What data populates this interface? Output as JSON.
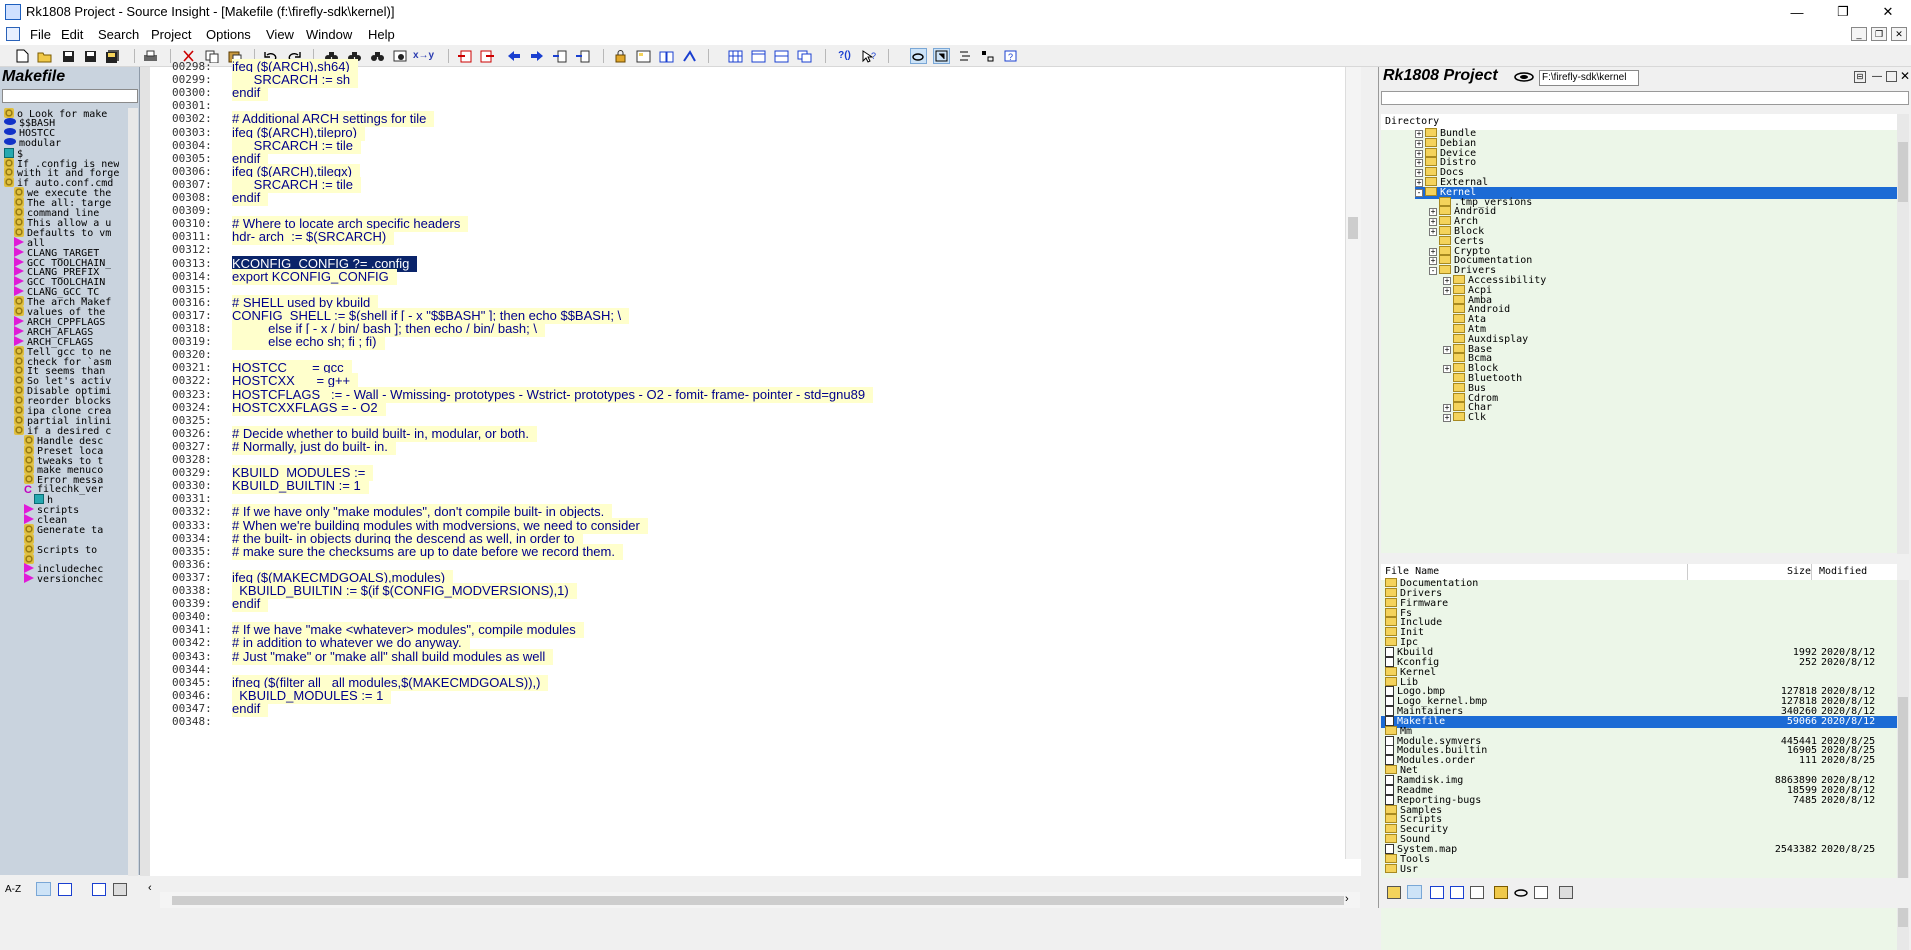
{
  "window": {
    "title": "Rk1808 Project - Source Insight - [Makefile (f:\\firefly-sdk\\kernel)]",
    "minimize": "—",
    "maximize": "❐",
    "close": "✕"
  },
  "menu": {
    "items": [
      "File",
      "Edit",
      "Search",
      "Project",
      "Options",
      "View",
      "Window",
      "Help"
    ],
    "mdi_buttons": [
      "_",
      "❐",
      "✕"
    ]
  },
  "symbol_panel": {
    "title": "Makefile",
    "items": [
      {
        "icon": "gear-icon",
        "text": "o Look for make",
        "indent": 0
      },
      {
        "icon": "variable-icon",
        "text": "$$BASH",
        "indent": 0
      },
      {
        "icon": "variable-icon",
        "text": "HOSTCC",
        "indent": 0
      },
      {
        "icon": "variable-icon",
        "text": "modular",
        "indent": 0
      },
      {
        "icon": "file-icon",
        "text": "$",
        "indent": 0
      },
      {
        "icon": "gear-icon",
        "text": "If .config is new",
        "indent": 0
      },
      {
        "icon": "gear-icon",
        "text": "with it and forge",
        "indent": 0
      },
      {
        "icon": "gear-icon",
        "text": "if auto.conf.cmd",
        "indent": 0
      },
      {
        "icon": "gear-icon",
        "text": "we execute the",
        "indent": 1
      },
      {
        "icon": "gear-icon",
        "text": "The all: targe",
        "indent": 1
      },
      {
        "icon": "gear-icon",
        "text": "command line",
        "indent": 1
      },
      {
        "icon": "gear-icon",
        "text": "This allow a u",
        "indent": 1
      },
      {
        "icon": "gear-icon",
        "text": "Defaults to vm",
        "indent": 1
      },
      {
        "icon": "target-icon",
        "text": "all",
        "indent": 1
      },
      {
        "icon": "target-icon",
        "text": "CLANG_TARGET",
        "indent": 1
      },
      {
        "icon": "target-icon",
        "text": "GCC_TOOLCHAIN_",
        "indent": 1
      },
      {
        "icon": "target-icon",
        "text": "CLANG_PREFIX",
        "indent": 1
      },
      {
        "icon": "target-icon",
        "text": "GCC_TOOLCHAIN",
        "indent": 1
      },
      {
        "icon": "target-icon",
        "text": "CLANG_GCC_TC",
        "indent": 1
      },
      {
        "icon": "gear-icon",
        "text": "The arch Makef",
        "indent": 1
      },
      {
        "icon": "gear-icon",
        "text": "values of the",
        "indent": 1
      },
      {
        "icon": "target-icon",
        "text": "ARCH_CPPFLAGS",
        "indent": 1
      },
      {
        "icon": "target-icon",
        "text": "ARCH_AFLAGS",
        "indent": 1
      },
      {
        "icon": "target-icon",
        "text": "ARCH_CFLAGS",
        "indent": 1
      },
      {
        "icon": "gear-icon",
        "text": "Tell gcc to ne",
        "indent": 1
      },
      {
        "icon": "gear-icon",
        "text": "check for `asm",
        "indent": 1
      },
      {
        "icon": "gear-icon",
        "text": "It seems than",
        "indent": 1
      },
      {
        "icon": "gear-icon",
        "text": "So let's activ",
        "indent": 1
      },
      {
        "icon": "gear-icon",
        "text": "Disable optimi",
        "indent": 1
      },
      {
        "icon": "gear-icon",
        "text": "reorder blocks",
        "indent": 1
      },
      {
        "icon": "gear-icon",
        "text": "ipa clone crea",
        "indent": 1
      },
      {
        "icon": "gear-icon",
        "text": "partial inlini",
        "indent": 1
      },
      {
        "icon": "gear-icon",
        "text": "if a desired c",
        "indent": 1
      },
      {
        "icon": "gear-icon",
        "text": "Handle desc",
        "indent": 2
      },
      {
        "icon": "gear-icon",
        "text": "Preset loca",
        "indent": 2
      },
      {
        "icon": "gear-icon",
        "text": "tweaks to t",
        "indent": 2
      },
      {
        "icon": "gear-icon",
        "text": "make menuco",
        "indent": 2
      },
      {
        "icon": "gear-icon",
        "text": "Error messa",
        "indent": 2
      },
      {
        "icon": "c-icon",
        "text": "filechk_ver",
        "indent": 2
      },
      {
        "icon": "file-icon",
        "text": "h",
        "indent": 3
      },
      {
        "icon": "target-icon",
        "text": "scripts",
        "indent": 2
      },
      {
        "icon": "target-icon",
        "text": "clean",
        "indent": 2
      },
      {
        "icon": "gear-icon",
        "text": "Generate ta",
        "indent": 2
      },
      {
        "icon": "gear-icon",
        "text": "",
        "indent": 2
      },
      {
        "icon": "gear-icon",
        "text": "Scripts to",
        "indent": 2
      },
      {
        "icon": "gear-icon",
        "text": "",
        "indent": 2
      },
      {
        "icon": "target-icon",
        "text": "includechec",
        "indent": 2
      },
      {
        "icon": "target-icon",
        "text": "versionchec",
        "indent": 2
      }
    ]
  },
  "editor": {
    "lines": [
      {
        "num": "00298:",
        "text": "ifeq ($(ARCH),sh64)"
      },
      {
        "num": "00299:",
        "text": "      SRCARCH := sh"
      },
      {
        "num": "00300:",
        "text": "endif"
      },
      {
        "num": "00301:",
        "text": ""
      },
      {
        "num": "00302:",
        "text": "# Additional ARCH settings for tile"
      },
      {
        "num": "00303:",
        "text": "ifeq ($(ARCH),tilepro)"
      },
      {
        "num": "00304:",
        "text": "      SRCARCH := tile"
      },
      {
        "num": "00305:",
        "text": "endif"
      },
      {
        "num": "00306:",
        "text": "ifeq ($(ARCH),tilegx)"
      },
      {
        "num": "00307:",
        "text": "      SRCARCH := tile"
      },
      {
        "num": "00308:",
        "text": "endif"
      },
      {
        "num": "00309:",
        "text": ""
      },
      {
        "num": "00310:",
        "text": "# Where to locate arch specific headers"
      },
      {
        "num": "00311:",
        "text": "hdr- arch  := $(SRCARCH)"
      },
      {
        "num": "00312:",
        "text": ""
      },
      {
        "num": "00313:",
        "text": "KCONFIG_CONFIG ?= .config",
        "selected": true
      },
      {
        "num": "00314:",
        "text": "export KCONFIG_CONFIG"
      },
      {
        "num": "00315:",
        "text": ""
      },
      {
        "num": "00316:",
        "text": "# SHELL used by kbuild"
      },
      {
        "num": "00317:",
        "text": "CONFIG_SHELL := $(shell if [ - x \"$$BASH\" ]; then echo $$BASH; \\"
      },
      {
        "num": "00318:",
        "text": "          else if [ - x / bin/ bash ]; then echo / bin/ bash; \\"
      },
      {
        "num": "00319:",
        "text": "          else echo sh; fi ; fi)"
      },
      {
        "num": "00320:",
        "text": ""
      },
      {
        "num": "00321:",
        "text": "HOSTCC       = gcc"
      },
      {
        "num": "00322:",
        "text": "HOSTCXX      = g++"
      },
      {
        "num": "00323:",
        "text": "HOSTCFLAGS   := - Wall - Wmissing- prototypes - Wstrict- prototypes - O2 - fomit- frame- pointer - std=gnu89"
      },
      {
        "num": "00324:",
        "text": "HOSTCXXFLAGS = - O2"
      },
      {
        "num": "00325:",
        "text": ""
      },
      {
        "num": "00326:",
        "text": "# Decide whether to build built- in, modular, or both."
      },
      {
        "num": "00327:",
        "text": "# Normally, just do built- in."
      },
      {
        "num": "00328:",
        "text": ""
      },
      {
        "num": "00329:",
        "text": "KBUILD_MODULES :="
      },
      {
        "num": "00330:",
        "text": "KBUILD_BUILTIN := 1"
      },
      {
        "num": "00331:",
        "text": ""
      },
      {
        "num": "00332:",
        "text": "# If we have only \"make modules\", don't compile built- in objects."
      },
      {
        "num": "00333:",
        "text": "# When we're building modules with modversions, we need to consider"
      },
      {
        "num": "00334:",
        "text": "# the built- in objects during the descend as well, in order to"
      },
      {
        "num": "00335:",
        "text": "# make sure the checksums are up to date before we record them."
      },
      {
        "num": "00336:",
        "text": ""
      },
      {
        "num": "00337:",
        "text": "ifeq ($(MAKECMDGOALS),modules)"
      },
      {
        "num": "00338:",
        "text": "  KBUILD_BUILTIN := $(if $(CONFIG_MODVERSIONS),1)"
      },
      {
        "num": "00339:",
        "text": "endif"
      },
      {
        "num": "00340:",
        "text": ""
      },
      {
        "num": "00341:",
        "text": "# If we have \"make <whatever> modules\", compile modules"
      },
      {
        "num": "00342:",
        "text": "# in addition to whatever we do anyway."
      },
      {
        "num": "00343:",
        "text": "# Just \"make\" or \"make all\" shall build modules as well"
      },
      {
        "num": "00344:",
        "text": ""
      },
      {
        "num": "00345:",
        "text": "ifneq ($(filter all _all modules,$(MAKECMDGOALS)),)"
      },
      {
        "num": "00346:",
        "text": "  KBUILD_MODULES := 1"
      },
      {
        "num": "00347:",
        "text": "endif"
      },
      {
        "num": "00348:",
        "text": ""
      }
    ]
  },
  "project_panel": {
    "title": "Rk1808 Project",
    "path": "F:\\firefly-sdk\\kernel",
    "directory_header": "Directory",
    "tree": [
      {
        "label": "Bundle",
        "level": 0,
        "expander": "+"
      },
      {
        "label": "Debian",
        "level": 0,
        "expander": "+"
      },
      {
        "label": "Device",
        "level": 0,
        "expander": "+"
      },
      {
        "label": "Distro",
        "level": 0,
        "expander": "+"
      },
      {
        "label": "Docs",
        "level": 0,
        "expander": "+"
      },
      {
        "label": "External",
        "level": 0,
        "expander": "+"
      },
      {
        "label": "Kernel",
        "level": 0,
        "expander": "-",
        "selected": true
      },
      {
        "label": ".tmp_versions",
        "level": 1,
        "expander": ""
      },
      {
        "label": "Android",
        "level": 1,
        "expander": "+"
      },
      {
        "label": "Arch",
        "level": 1,
        "expander": "+"
      },
      {
        "label": "Block",
        "level": 1,
        "expander": "+"
      },
      {
        "label": "Certs",
        "level": 1,
        "expander": ""
      },
      {
        "label": "Crypto",
        "level": 1,
        "expander": "+"
      },
      {
        "label": "Documentation",
        "level": 1,
        "expander": "+"
      },
      {
        "label": "Drivers",
        "level": 1,
        "expander": "-"
      },
      {
        "label": "Accessibility",
        "level": 2,
        "expander": "+"
      },
      {
        "label": "Acpi",
        "level": 2,
        "expander": "+"
      },
      {
        "label": "Amba",
        "level": 2,
        "expander": ""
      },
      {
        "label": "Android",
        "level": 2,
        "expander": ""
      },
      {
        "label": "Ata",
        "level": 2,
        "expander": ""
      },
      {
        "label": "Atm",
        "level": 2,
        "expander": ""
      },
      {
        "label": "Auxdisplay",
        "level": 2,
        "expander": ""
      },
      {
        "label": "Base",
        "level": 2,
        "expander": "+"
      },
      {
        "label": "Bcma",
        "level": 2,
        "expander": ""
      },
      {
        "label": "Block",
        "level": 2,
        "expander": "+"
      },
      {
        "label": "Bluetooth",
        "level": 2,
        "expander": ""
      },
      {
        "label": "Bus",
        "level": 2,
        "expander": ""
      },
      {
        "label": "Cdrom",
        "level": 2,
        "expander": ""
      },
      {
        "label": "Char",
        "level": 2,
        "expander": "+"
      },
      {
        "label": "Clk",
        "level": 2,
        "expander": "+"
      }
    ],
    "file_columns": {
      "name": "File Name",
      "size": "Size",
      "modified": "Modified"
    },
    "files": [
      {
        "name": "Documentation",
        "type": "folder",
        "size": "",
        "modified": ""
      },
      {
        "name": "Drivers",
        "type": "folder",
        "size": "",
        "modified": ""
      },
      {
        "name": "Firmware",
        "type": "folder",
        "size": "",
        "modified": ""
      },
      {
        "name": "Fs",
        "type": "folder",
        "size": "",
        "modified": ""
      },
      {
        "name": "Include",
        "type": "folder",
        "size": "",
        "modified": ""
      },
      {
        "name": "Init",
        "type": "folder",
        "size": "",
        "modified": ""
      },
      {
        "name": "Ipc",
        "type": "folder",
        "size": "",
        "modified": ""
      },
      {
        "name": "Kbuild",
        "type": "file",
        "size": "1992",
        "modified": "2020/8/12"
      },
      {
        "name": "Kconfig",
        "type": "file",
        "size": "252",
        "modified": "2020/8/12"
      },
      {
        "name": "Kernel",
        "type": "folder",
        "size": "",
        "modified": ""
      },
      {
        "name": "Lib",
        "type": "folder",
        "size": "",
        "modified": ""
      },
      {
        "name": "Logo.bmp",
        "type": "file",
        "size": "127818",
        "modified": "2020/8/12"
      },
      {
        "name": "Logo_kernel.bmp",
        "type": "file",
        "size": "127818",
        "modified": "2020/8/12"
      },
      {
        "name": "Maintainers",
        "type": "file",
        "size": "340260",
        "modified": "2020/8/12"
      },
      {
        "name": "Makefile",
        "type": "file",
        "size": "59066",
        "modified": "2020/8/12",
        "selected": true
      },
      {
        "name": "Mm",
        "type": "folder",
        "size": "",
        "modified": ""
      },
      {
        "name": "Module.symvers",
        "type": "file",
        "size": "445441",
        "modified": "2020/8/25"
      },
      {
        "name": "Modules.builtin",
        "type": "file",
        "size": "16905",
        "modified": "2020/8/25"
      },
      {
        "name": "Modules.order",
        "type": "file",
        "size": "111",
        "modified": "2020/8/25"
      },
      {
        "name": "Net",
        "type": "folder",
        "size": "",
        "modified": ""
      },
      {
        "name": "Ramdisk.img",
        "type": "file",
        "size": "8863890",
        "modified": "2020/8/12"
      },
      {
        "name": "Readme",
        "type": "file",
        "size": "18599",
        "modified": "2020/8/12"
      },
      {
        "name": "Reporting-bugs",
        "type": "file",
        "size": "7485",
        "modified": "2020/8/12"
      },
      {
        "name": "Samples",
        "type": "folder",
        "size": "",
        "modified": ""
      },
      {
        "name": "Scripts",
        "type": "folder",
        "size": "",
        "modified": ""
      },
      {
        "name": "Security",
        "type": "folder",
        "size": "",
        "modified": ""
      },
      {
        "name": "Sound",
        "type": "folder",
        "size": "",
        "modified": ""
      },
      {
        "name": "System.map",
        "type": "file",
        "size": "2543382",
        "modified": "2020/8/25"
      },
      {
        "name": "Tools",
        "type": "folder",
        "size": "",
        "modified": ""
      },
      {
        "name": "Usr",
        "type": "folder",
        "size": "",
        "modified": ""
      }
    ]
  },
  "bottom_left": {
    "az_label": "A-Z"
  },
  "colors": {
    "editor_bg": "#ffffff",
    "code_highlight": "#ffffcc",
    "code_text": "#00008b",
    "selection": "#0a246a",
    "panel_bg": "#c9d3de",
    "tree_bg": "#ecf6e8",
    "tree_selection": "#1c6bd5"
  }
}
